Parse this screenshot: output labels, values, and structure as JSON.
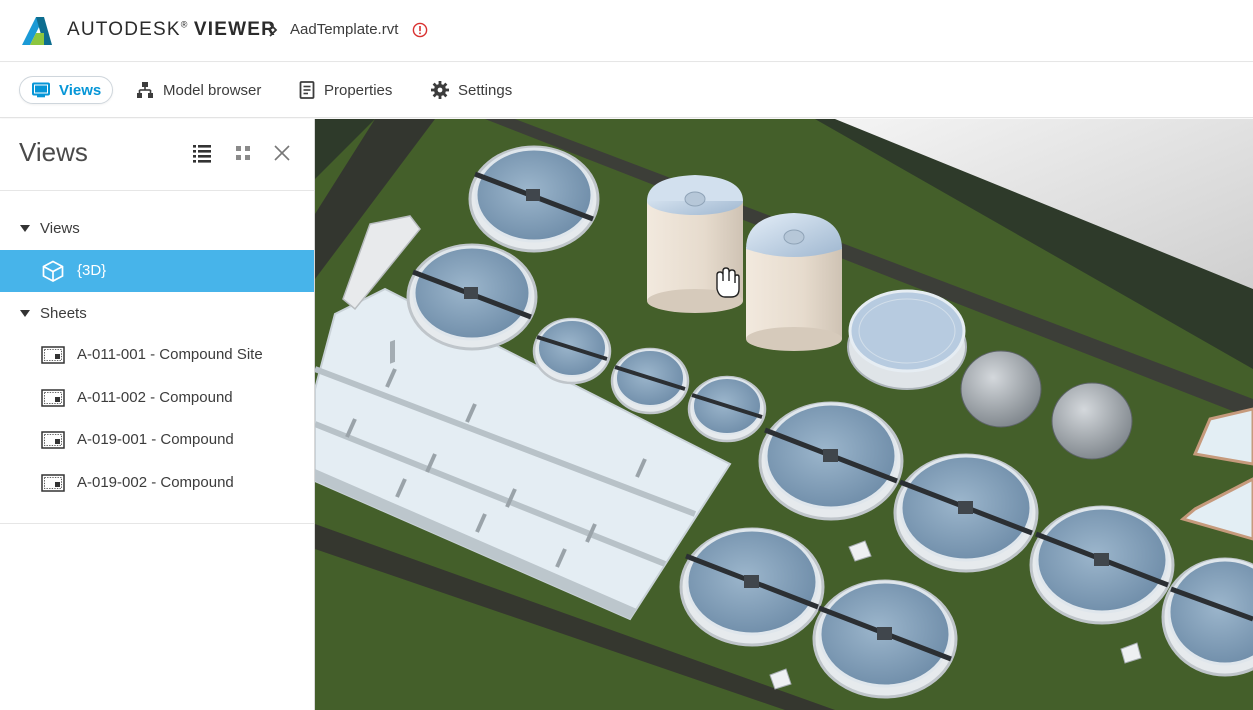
{
  "header": {
    "brand_autodesk": "AUTODESK",
    "brand_reg": "®",
    "brand_viewer": "VIEWER",
    "file_name": "AadTemplate.rvt"
  },
  "tabs": [
    {
      "label": "Views",
      "icon": "monitor-icon",
      "active": true
    },
    {
      "label": "Model browser",
      "icon": "hierarchy-icon",
      "active": false
    },
    {
      "label": "Properties",
      "icon": "document-icon",
      "active": false
    },
    {
      "label": "Settings",
      "icon": "gear-icon",
      "active": false
    }
  ],
  "panel": {
    "title": "Views",
    "groups": {
      "views": {
        "label": "Views",
        "items": [
          {
            "label": "{3D}",
            "icon": "cube-icon",
            "selected": true
          }
        ]
      },
      "sheets": {
        "label": "Sheets",
        "items": [
          {
            "label": "A-011-001 - Compound Site",
            "icon": "sheet-icon"
          },
          {
            "label": "A-011-002 - Compound",
            "icon": "sheet-icon"
          },
          {
            "label": "A-019-001 - Compound",
            "icon": "sheet-icon"
          },
          {
            "label": "A-019-002 - Compound",
            "icon": "sheet-icon"
          }
        ]
      }
    }
  },
  "colors": {
    "accent": "#0696d7",
    "selection": "#47b4ea",
    "ground": "#3f5c27",
    "warning": "#d9302f"
  }
}
